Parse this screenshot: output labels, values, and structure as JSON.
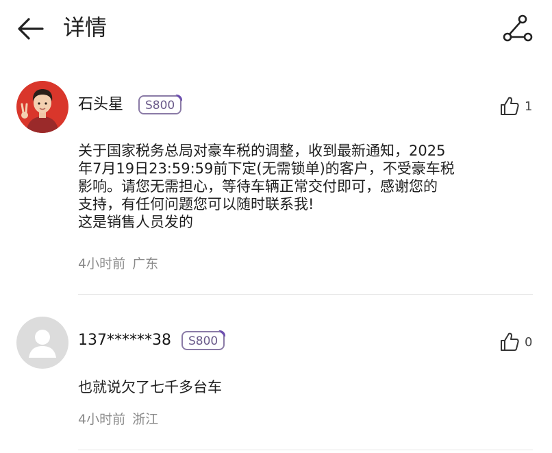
{
  "header": {
    "title": "详情"
  },
  "comments": [
    {
      "username": "石头星",
      "badge": "S800",
      "likes": "1",
      "lines": [
        "关于国家税务总局对豪车税的调整，收到最新通知，2025",
        "年7月19日23:59:59前下定(无需锁单)的客户，不受豪车税",
        "影响。请您无需担心，等待车辆正常交付即可，感谢您的",
        "支持，有任何问题您可以随时联系我!",
        "这是销售人员发的"
      ],
      "time": "4小时前",
      "location": "广东"
    },
    {
      "username": "137******38",
      "badge": "S800",
      "likes": "0",
      "lines": [
        "也就说欠了七千多台车"
      ],
      "time": "4小时前",
      "location": "浙江"
    }
  ],
  "colors": {
    "badge_border": "#8a7aa6",
    "badge_accent": "#6d4fb0",
    "meta_text": "#8a8a8a",
    "avatar_bg": "#d9362b"
  }
}
